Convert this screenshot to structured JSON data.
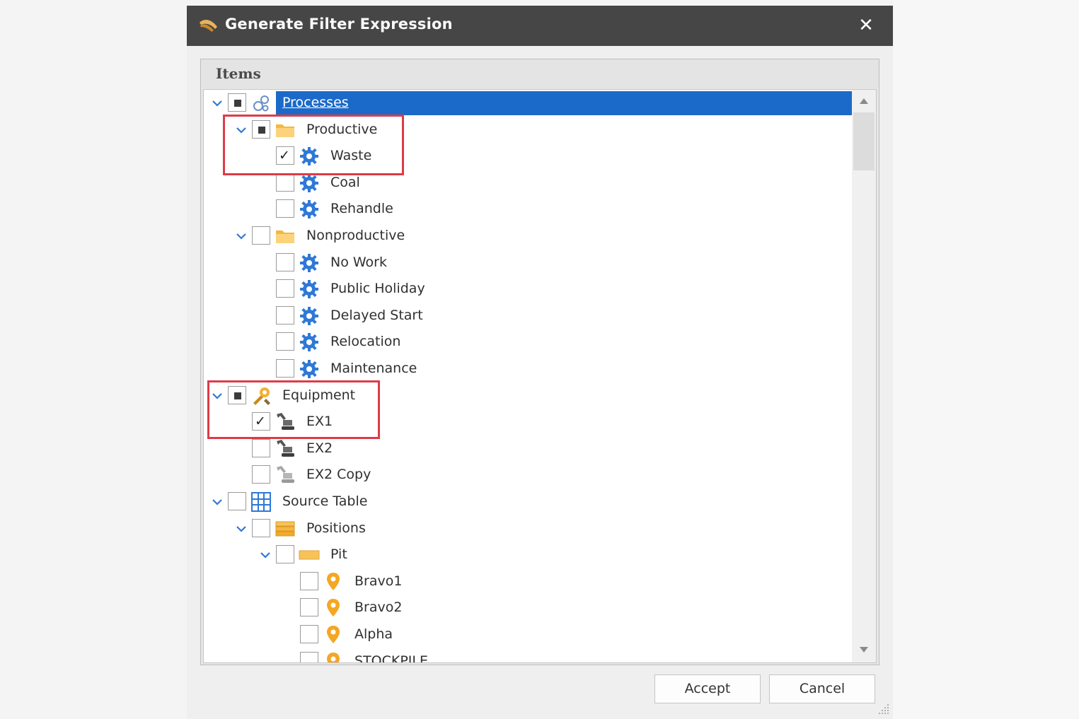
{
  "dialog": {
    "title": "Generate Filter Expression",
    "close_label": "✕",
    "items_header": "Items",
    "buttons": {
      "accept": "Accept",
      "cancel": "Cancel"
    }
  },
  "tree": [
    {
      "label": "Processes",
      "level": 0,
      "expanded": true,
      "check": "indeterminate",
      "icon": "processes-icon",
      "selected": true
    },
    {
      "label": "Productive",
      "level": 1,
      "expanded": true,
      "check": "indeterminate",
      "icon": "folder-icon"
    },
    {
      "label": "Waste",
      "level": 2,
      "check": "checked",
      "icon": "gear-icon"
    },
    {
      "label": "Coal",
      "level": 2,
      "check": "unchecked",
      "icon": "gear-icon"
    },
    {
      "label": "Rehandle",
      "level": 2,
      "check": "unchecked",
      "icon": "gear-icon"
    },
    {
      "label": "Nonproductive",
      "level": 1,
      "expanded": true,
      "check": "unchecked",
      "icon": "folder-icon"
    },
    {
      "label": "No Work",
      "level": 2,
      "check": "unchecked",
      "icon": "gear-icon"
    },
    {
      "label": "Public Holiday",
      "level": 2,
      "check": "unchecked",
      "icon": "gear-icon"
    },
    {
      "label": "Delayed Start",
      "level": 2,
      "check": "unchecked",
      "icon": "gear-icon"
    },
    {
      "label": "Relocation",
      "level": 2,
      "check": "unchecked",
      "icon": "gear-icon"
    },
    {
      "label": "Maintenance",
      "level": 2,
      "check": "unchecked",
      "icon": "gear-icon"
    },
    {
      "label": "Equipment",
      "level": 0,
      "expanded": true,
      "check": "indeterminate",
      "icon": "equipment-icon"
    },
    {
      "label": "EX1",
      "level": 1,
      "check": "checked",
      "icon": "excavator-icon"
    },
    {
      "label": "EX2",
      "level": 1,
      "check": "unchecked",
      "icon": "excavator-icon"
    },
    {
      "label": "EX2 Copy",
      "level": 1,
      "check": "unchecked",
      "icon": "excavator-faded-icon"
    },
    {
      "label": "Source Table",
      "level": 0,
      "expanded": true,
      "check": "unchecked",
      "icon": "table-icon"
    },
    {
      "label": "Positions",
      "level": 1,
      "expanded": true,
      "check": "unchecked",
      "icon": "layers-icon"
    },
    {
      "label": "Pit",
      "level": 2,
      "expanded": true,
      "check": "unchecked",
      "icon": "pit-icon"
    },
    {
      "label": "Bravo1",
      "level": 3,
      "check": "unchecked",
      "icon": "map-pin-icon"
    },
    {
      "label": "Bravo2",
      "level": 3,
      "check": "unchecked",
      "icon": "map-pin-icon"
    },
    {
      "label": "Alpha",
      "level": 3,
      "check": "unchecked",
      "icon": "map-pin-icon"
    },
    {
      "label": "STOCKPILE",
      "level": 3,
      "check": "unchecked",
      "icon": "map-pin-icon"
    }
  ],
  "colors": {
    "titlebar": "#464646",
    "selection": "#1b6ac9",
    "highlight": "#de3b47",
    "gear": "#2f78d6",
    "folder": "#f7c25a",
    "pin": "#f5a623"
  }
}
